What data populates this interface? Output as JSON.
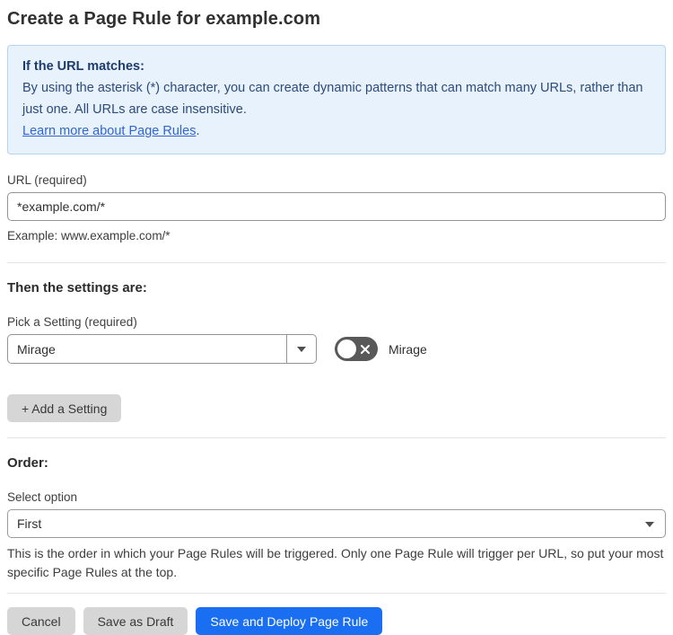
{
  "page": {
    "title": "Create a Page Rule for example.com"
  },
  "info_box": {
    "heading": "If the URL matches:",
    "body": "By using the asterisk (*) character, you can create dynamic patterns that can match many URLs, rather than just one. All URLs are case insensitive.",
    "link_text": "Learn more about Page Rules",
    "link_suffix": "."
  },
  "url_field": {
    "label": "URL (required)",
    "value": "*example.com/*",
    "helper": "Example: www.example.com/*"
  },
  "settings_section": {
    "heading": "Then the settings are:",
    "setting_label": "Pick a Setting (required)",
    "setting_value": "Mirage",
    "toggle_label": "Mirage",
    "toggle_state": "off",
    "add_setting_button": "+ Add a Setting"
  },
  "order_section": {
    "heading": "Order:",
    "select_label": "Select option",
    "select_value": "First",
    "helper": "This is the order in which your Page Rules will be triggered. Only one Page Rule will trigger per URL, so put your most specific Page Rules at the top."
  },
  "footer": {
    "cancel_label": "Cancel",
    "save_draft_label": "Save as Draft",
    "save_deploy_label": "Save and Deploy Page Rule"
  },
  "colors": {
    "info_bg": "#e8f2fc",
    "info_border": "#b7d4ef",
    "info_heading": "#1d3c6e",
    "info_text": "#2c4a7c",
    "link": "#2f66d0",
    "primary_button": "#1a6ef2",
    "gray_button": "#d6d6d6",
    "toggle_off_bg": "#595959"
  }
}
